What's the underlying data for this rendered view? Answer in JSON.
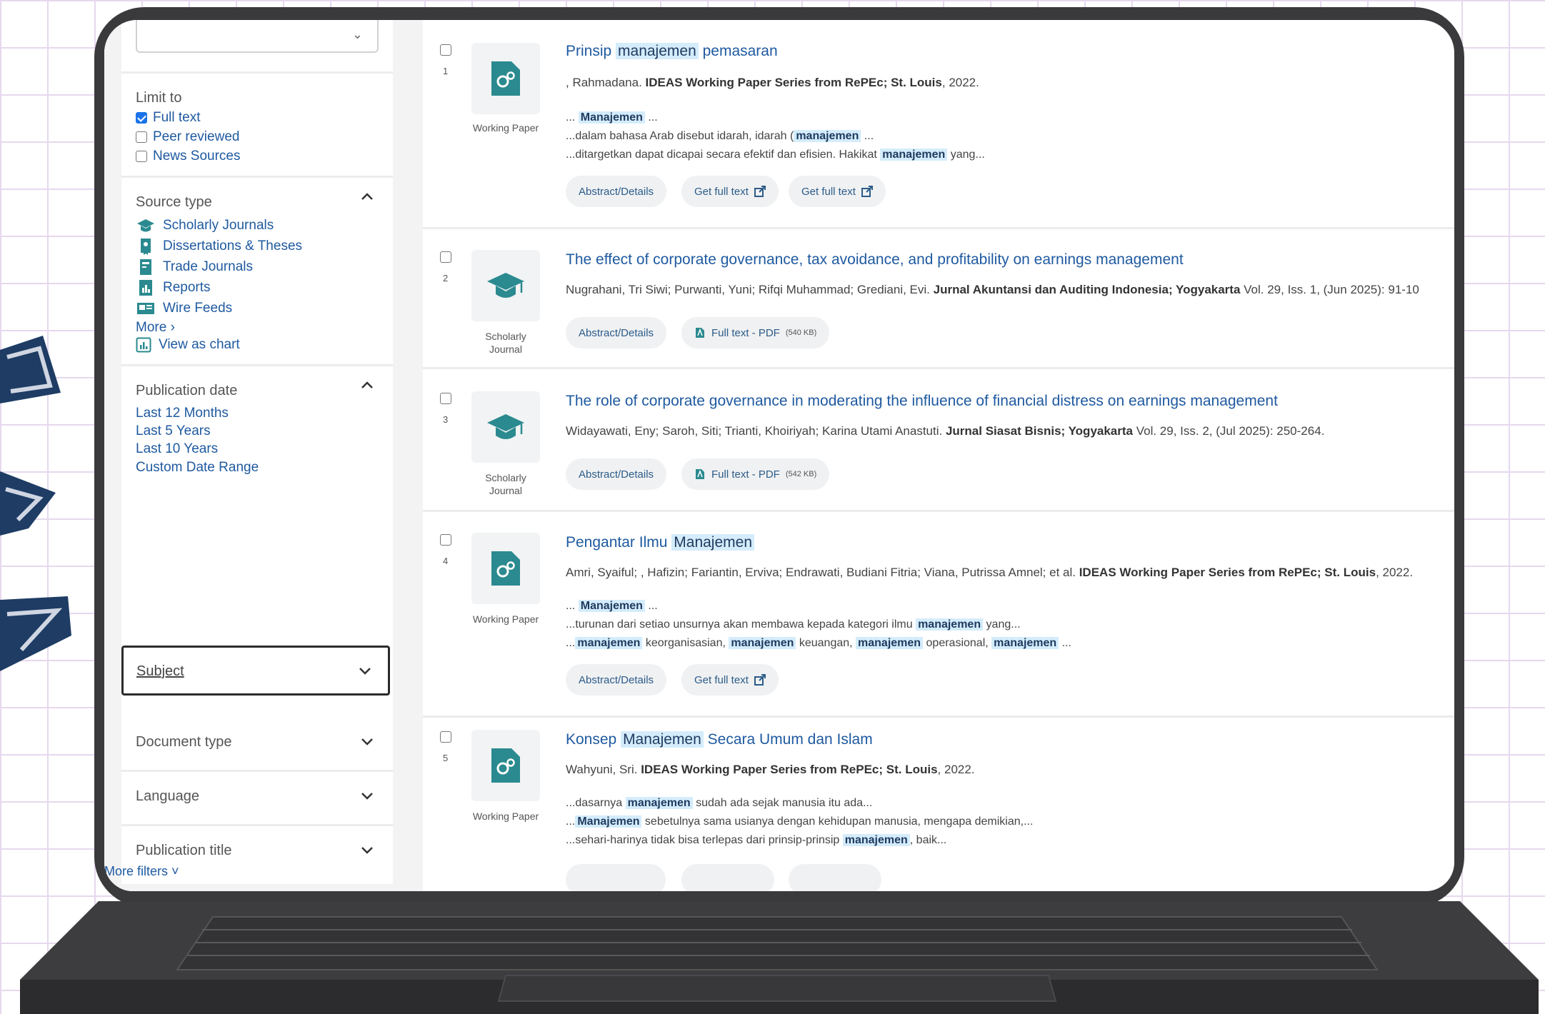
{
  "sidebar": {
    "limit_to": {
      "title": "Limit to",
      "options": [
        {
          "label": "Full text",
          "checked": true
        },
        {
          "label": "Peer reviewed",
          "checked": false
        },
        {
          "label": "News Sources",
          "checked": false
        }
      ]
    },
    "source_type": {
      "title": "Source type",
      "items": [
        {
          "label": "Scholarly Journals",
          "icon": "graduation-cap-icon"
        },
        {
          "label": "Dissertations & Theses",
          "icon": "thesis-icon"
        },
        {
          "label": "Trade Journals",
          "icon": "trade-journal-icon"
        },
        {
          "label": "Reports",
          "icon": "report-icon"
        },
        {
          "label": "Wire Feeds",
          "icon": "wire-feed-icon"
        }
      ],
      "more_label": "More ›",
      "view_chart_label": "View as chart"
    },
    "publication_date": {
      "title": "Publication date",
      "options": [
        "Last 12 Months",
        "Last 5 Years",
        "Last 10 Years",
        "Custom Date Range"
      ]
    },
    "collapsed": {
      "subject": "Subject",
      "document_type": "Document type",
      "language": "Language",
      "publication_title": "Publication title"
    },
    "more_filters": "More filters ˅"
  },
  "results": [
    {
      "number": "1",
      "doc_type": "Working Paper",
      "title_pre": "Prinsip ",
      "title_hl": "manajemen",
      "title_post": " pemasaran",
      "meta_pre": ", Rahmadana. ",
      "meta_bold": "IDEAS Working Paper Series from RePEc; St. Louis",
      "meta_post": ", 2022.",
      "snip1_pre": "... ",
      "snip1_hl": "Manajemen",
      "snip1_post": " ...",
      "snip2_pre": "...dalam bahasa Arab disebut idarah, idarah (",
      "snip2_hl": "manajemen",
      "snip2_post": " ...",
      "snip3_pre": "...ditargetkan dapat dicapai secara efektif dan efisien. Hakikat ",
      "snip3_hl": "manajemen",
      "snip3_post": " yang...",
      "btn_abstract": "Abstract/Details",
      "btn_full1": "Get full text",
      "btn_full2": "Get full text"
    },
    {
      "number": "2",
      "doc_type_1": "Scholarly",
      "doc_type_2": "Journal",
      "title": "The effect of corporate governance, tax avoidance, and profitability on earnings management",
      "meta_pre": "Nugrahani, Tri Siwi; Purwanti, Yuni; Rifqi Muhammad; Grediani, Evi. ",
      "meta_bold": "Jurnal Akuntansi dan Auditing Indonesia; Yogyakarta",
      "meta_post": " Vol. 29, Iss. 1,  (Jun 2025): 91-10",
      "btn_abstract": "Abstract/Details",
      "btn_pdf": "Full text - PDF",
      "btn_pdf_size": "(540 KB)"
    },
    {
      "number": "3",
      "doc_type_1": "Scholarly",
      "doc_type_2": "Journal",
      "title": "The role of corporate governance in moderating the influence of financial distress on earnings management",
      "meta_pre": "Widayawati, Eny; Saroh, Siti; Trianti, Khoiriyah; Karina Utami Anastuti. ",
      "meta_bold": "Jurnal Siasat Bisnis; Yogyakarta",
      "meta_post": " Vol. 29, Iss. 2,  (Jul 2025): 250-264.",
      "btn_abstract": "Abstract/Details",
      "btn_pdf": "Full text - PDF",
      "btn_pdf_size": "(542 KB)"
    },
    {
      "number": "4",
      "doc_type": "Working Paper",
      "title_pre": "Pengantar Ilmu ",
      "title_hl": "Manajemen",
      "meta_pre": "Amri, Syaiful; , Hafizin; Fariantin, Erviva; Endrawati, Budiani Fitria; Viana, Putrissa Amnel; et al. ",
      "meta_bold": "IDEAS Working Paper Series from RePEc; St. Louis",
      "meta_post": ", 2022.",
      "snip1_pre": "... ",
      "snip1_hl": "Manajemen",
      "snip1_post": " ...",
      "snip2_pre": "...turunan dari setiao unsurnya akan membawa kepada kategori ilmu ",
      "snip2_hl": "manajemen",
      "snip2_post": " yang...",
      "snip3_pre": "...",
      "snip3_hl1": "manajemen",
      "snip3_t1": " keorganisasian, ",
      "snip3_hl2": "manajemen",
      "snip3_t2": " keuangan, ",
      "snip3_hl3": "manajemen",
      "snip3_t3": " operasional, ",
      "snip3_hl4": "manajemen",
      "snip3_post": " ...",
      "btn_abstract": "Abstract/Details",
      "btn_full1": "Get full text"
    },
    {
      "number": "5",
      "doc_type": "Working Paper",
      "title_pre": "Konsep ",
      "title_hl": "Manajemen",
      "title_post": " Secara Umum dan Islam",
      "meta_pre": "Wahyuni, Sri. ",
      "meta_bold": "IDEAS Working Paper Series from RePEc; St. Louis",
      "meta_post": ", 2022.",
      "snip1_pre": "...dasarnya ",
      "snip1_hl": "manajemen",
      "snip1_post": " sudah ada sejak manusia itu ada...",
      "snip2_pre": "...",
      "snip2_hl": "Manajemen",
      "snip2_post": " sebetulnya sama usianya dengan kehidupan manusia, mengapa demikian,...",
      "snip3_pre": "...sehari-harinya tidak bisa terlepas dari prinsip-prinsip ",
      "snip3_hl": "manajemen",
      "snip3_post": ", baik..."
    }
  ],
  "colors": {
    "link": "#1f5aa0",
    "highlight": "#d4ecfb",
    "teal_icon": "#2a8a8f",
    "laptop_body": "#3a3a3c"
  }
}
